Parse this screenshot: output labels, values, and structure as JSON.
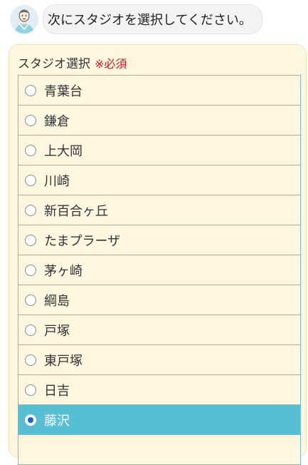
{
  "chat": {
    "avatar_icon": "instructor-avatar-icon",
    "message": "次にスタジオを選択してください。"
  },
  "studio_select": {
    "title": "スタジオ選択",
    "required_label": "※必須",
    "selected": "藤沢",
    "options": [
      {
        "label": "青葉台"
      },
      {
        "label": "鎌倉"
      },
      {
        "label": "上大岡"
      },
      {
        "label": "川崎"
      },
      {
        "label": "新百合ヶ丘"
      },
      {
        "label": "たまプラーザ"
      },
      {
        "label": "茅ヶ崎"
      },
      {
        "label": "綱島"
      },
      {
        "label": "戸塚"
      },
      {
        "label": "東戸塚"
      },
      {
        "label": "日吉"
      },
      {
        "label": "藤沢"
      },
      {
        "label": ""
      }
    ]
  },
  "colors": {
    "panel_bg": "#fdf7e0",
    "border": "#6cc3d5",
    "selected_bg": "#56bfd4",
    "required": "#d0191e",
    "radio_dot": "#1a5fd8"
  }
}
